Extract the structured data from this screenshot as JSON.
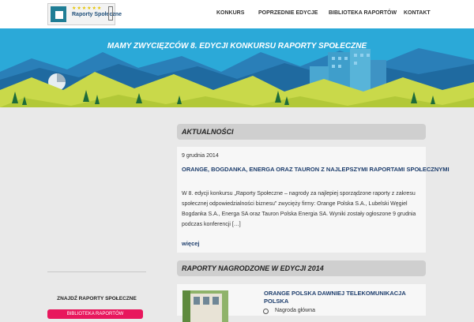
{
  "header": {
    "logo_text": "Raporty Społeczne",
    "logo_stars": "★★★★★★",
    "nav": [
      "KONKURS",
      "POPRZEDNIE EDYCJE",
      "BIBLIOTEKA RAPORTÓW",
      "KONTAKT"
    ]
  },
  "banner": {
    "title": "MAMY ZWYCIĘZCÓW 8. EDYCJI KONKURSU RAPORTY SPOŁECZNE"
  },
  "news": {
    "heading": "AKTUALNOŚCI",
    "date": "9 grudnia 2014",
    "title": "ORANGE, BOGDANKA, ENERGA ORAZ TAURON Z NAJLEPSZYMI RAPORTAMI SPOŁECZNYMI",
    "excerpt": "W 8. edycji konkursu „Raporty Społeczne – nagrody za najlepiej sporządzone raporty z zakresu społecznej odpowiedzialności biznesu” zwycięży firmy: Orange Polska S.A., Lubelski Węgiel Bogdanka S.A., Energa SA oraz Tauron Polska Energia SA. Wyniki zostały ogłoszone 9 grudnia podczas konferencji […]",
    "more": "więcej"
  },
  "awards": {
    "heading": "RAPORTY NAGRODZONE W EDYCJI 2014",
    "company": "ORANGE POLSKA DAWNIEJ TELEKOMUNIKACJA POLSKA",
    "label": "Nagroda główna"
  },
  "sidebar": {
    "title": "ZNAJDŹ RAPORTY SPOŁECZNE",
    "button": "BIBLIOTEKA RAPORTÓW"
  },
  "colors": {
    "sky": "#2ba9d8",
    "hills": "#c9d94a",
    "accent_button": "#e8175d",
    "link": "#1f3f6e"
  }
}
